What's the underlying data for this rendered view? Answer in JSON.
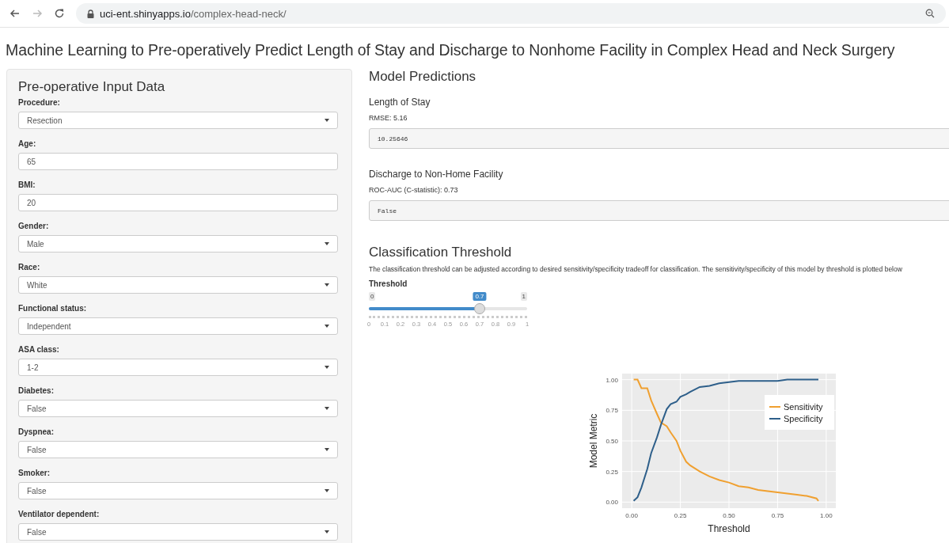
{
  "browser": {
    "back_disabled": false,
    "forward_disabled": true,
    "url_host": "uci-ent.shinyapps.io",
    "url_path": "/complex-head-neck/"
  },
  "page_title": "Machine Learning to Pre-operatively Predict Length of Stay and Discharge to Nonhome Facility in Complex Head and Neck Surgery",
  "input_panel": {
    "title": "Pre-operative Input Data",
    "fields": [
      {
        "label": "Procedure:",
        "kind": "select",
        "value": "Resection"
      },
      {
        "label": "Age:",
        "kind": "number",
        "value": "65"
      },
      {
        "label": "BMI:",
        "kind": "number",
        "value": "20"
      },
      {
        "label": "Gender:",
        "kind": "select",
        "value": "Male"
      },
      {
        "label": "Race:",
        "kind": "select",
        "value": "White"
      },
      {
        "label": "Functional status:",
        "kind": "select",
        "value": "Independent"
      },
      {
        "label": "ASA class:",
        "kind": "select",
        "value": "1-2"
      },
      {
        "label": "Diabetes:",
        "kind": "select",
        "value": "False"
      },
      {
        "label": "Dyspnea:",
        "kind": "select",
        "value": "False"
      },
      {
        "label": "Smoker:",
        "kind": "select",
        "value": "False"
      },
      {
        "label": "Ventilator dependent:",
        "kind": "select",
        "value": "False"
      }
    ]
  },
  "predictions": {
    "title": "Model Predictions",
    "outputs": [
      {
        "title": "Length of Stay",
        "metric": "RMSE: 5.16",
        "value": "10.25646"
      },
      {
        "title": "Discharge to Non-Home Facility",
        "metric": "ROC-AUC (C-statistic): 0.73",
        "value": "False"
      }
    ]
  },
  "threshold": {
    "title": "Classification Threshold",
    "description": "The classification threshold can be adjusted according to desired sensitivity/specificity tradeoff for classification. The sensitivity/specificity of this model by threshold is plotted below",
    "slider": {
      "label": "Threshold",
      "min_label": "0",
      "max_label": "1",
      "value_label": "0.7",
      "level": 0.7,
      "grid_labels": [
        "0",
        "0.1",
        "0.2",
        "0.3",
        "0.4",
        "0.5",
        "0.6",
        "0.7",
        "0.8",
        "0.9",
        "1"
      ]
    },
    "chart_data": {
      "type": "line",
      "grid": true,
      "legend": true,
      "xlabel": "Threshold",
      "ylabel": "Model Metric",
      "xlim": [
        0,
        1
      ],
      "ylim": [
        0,
        1
      ],
      "xticks": [
        {
          "value": 0,
          "label": "0.00"
        },
        {
          "value": 0.25,
          "label": "0.25"
        },
        {
          "value": 0.5,
          "label": "0.50"
        },
        {
          "value": 0.75,
          "label": "0.75"
        },
        {
          "value": 1,
          "label": "1.00"
        }
      ],
      "yticks": [
        {
          "value": 0,
          "label": "0.00"
        },
        {
          "value": 0.25,
          "label": "0.25"
        },
        {
          "value": 0.5,
          "label": "0.50"
        },
        {
          "value": 0.75,
          "label": "0.75"
        },
        {
          "value": 1,
          "label": "1.00"
        }
      ],
      "x": [
        0.01,
        0.03,
        0.05,
        0.08,
        0.1,
        0.13,
        0.15,
        0.18,
        0.2,
        0.23,
        0.25,
        0.28,
        0.3,
        0.35,
        0.4,
        0.45,
        0.5,
        0.55,
        0.6,
        0.65,
        0.7,
        0.75,
        0.8,
        0.85,
        0.9,
        0.95,
        0.96
      ],
      "series": [
        {
          "name": "Sensitivity",
          "color": "#f0a030",
          "values": [
            1.0,
            1.0,
            0.93,
            0.93,
            0.83,
            0.72,
            0.65,
            0.62,
            0.57,
            0.5,
            0.42,
            0.33,
            0.3,
            0.25,
            0.21,
            0.18,
            0.16,
            0.13,
            0.12,
            0.1,
            0.09,
            0.08,
            0.07,
            0.06,
            0.05,
            0.03,
            0.01
          ]
        },
        {
          "name": "Specificity",
          "color": "#2e5f8a",
          "values": [
            0.01,
            0.04,
            0.12,
            0.27,
            0.4,
            0.53,
            0.63,
            0.76,
            0.8,
            0.82,
            0.86,
            0.88,
            0.9,
            0.94,
            0.95,
            0.97,
            0.98,
            0.99,
            0.99,
            0.99,
            0.99,
            0.99,
            1.0,
            1.0,
            1.0,
            1.0,
            1.0
          ]
        }
      ]
    }
  }
}
